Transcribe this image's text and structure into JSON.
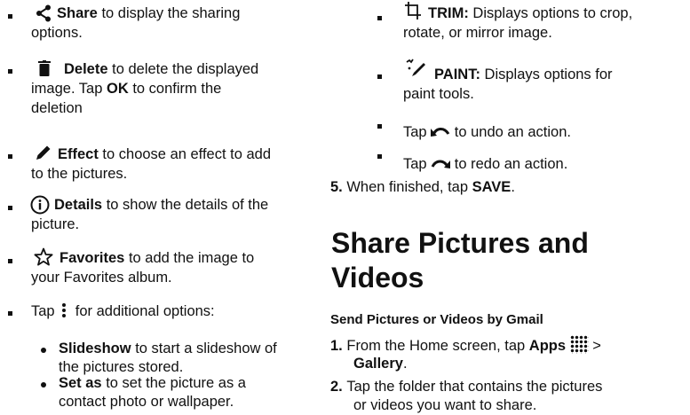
{
  "left": {
    "share": {
      "label": "Share",
      "text": " to display the sharing",
      "cont": "options."
    },
    "delete": {
      "label": "Delete",
      "text": " to delete the displayed",
      "line2a": "image. Tap ",
      "ok": "OK",
      "line2b": " to confirm the",
      "line3": "deletion"
    },
    "effect": {
      "label": "Effect",
      "text": " to choose an effect to add",
      "cont": "to the pictures."
    },
    "details": {
      "label": "Details",
      "text": " to show the details of the",
      "cont": "picture."
    },
    "favorites": {
      "label": "Favorites",
      "text": " to add the image to",
      "cont": "your Favorites album."
    },
    "more": {
      "pre": "Tap ",
      "post": " for additional options:"
    },
    "slideshow": {
      "label": "Slideshow",
      "text": " to start a slideshow of",
      "cont": "the pictures stored."
    },
    "setas": {
      "label": "Set as",
      "text": " to set the picture as a",
      "cont": "contact photo or wallpaper."
    }
  },
  "right": {
    "trim": {
      "label": "TRIM:",
      "text": " Displays options to crop,",
      "cont": "rotate, or mirror image."
    },
    "paint": {
      "label": "PAINT:",
      "text": " Displays options for",
      "cont": "paint tools."
    },
    "undo": {
      "pre": "Tap ",
      "post": " to undo an action."
    },
    "redo": {
      "pre": "Tap ",
      "post": " to redo an action."
    },
    "step5": {
      "num": "5.",
      "text": "When finished, tap ",
      "save": "SAVE",
      "end": "."
    },
    "heading": {
      "line1": "Share Pictures and",
      "line2": "Videos"
    },
    "subheading": "Send Pictures or Videos by Gmail",
    "step1": {
      "num": "1.",
      "text": "From the Home screen, tap ",
      "apps": "Apps",
      "sep": " >",
      "gallery": "Gallery",
      "end": "."
    },
    "step2": {
      "num": "2.",
      "text": "Tap the folder that contains the pictures",
      "cont": "or videos you want to share."
    }
  },
  "colors": {
    "text": "#111111",
    "background": "#ffffff"
  }
}
